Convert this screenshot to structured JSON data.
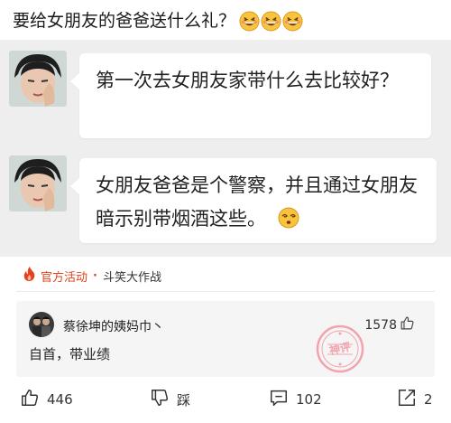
{
  "post": {
    "title": "要给女朋友的爸爸送什么礼？",
    "title_emojis": [
      "grin-squint-emoji",
      "grin-squint-emoji",
      "grin-squint-emoji"
    ]
  },
  "chat": {
    "messages": [
      {
        "text": "第一次去女朋友家带什么去比较好？"
      },
      {
        "text": "女朋友爸爸是个警察，并且通过女朋友暗示别带烟酒这些。",
        "emoji": "dizzy-face-emoji"
      }
    ]
  },
  "activity": {
    "icon": "flame-icon",
    "label": "官方活动",
    "separator": "·",
    "name": "斗笑大作战"
  },
  "top_comment": {
    "username": "蔡徐坤的姨妈巾丶",
    "likes": "1578",
    "text": "自首，带业绩",
    "stamp": "神评"
  },
  "toolbar": {
    "like_count": "446",
    "dislike_label": "踩",
    "comment_count": "102",
    "share_count": "2"
  },
  "colors": {
    "accent": "#e2431e",
    "stamp": "#f2a3ad",
    "media_bg": "#eeeeee",
    "card_bg": "#f5f5f5"
  }
}
